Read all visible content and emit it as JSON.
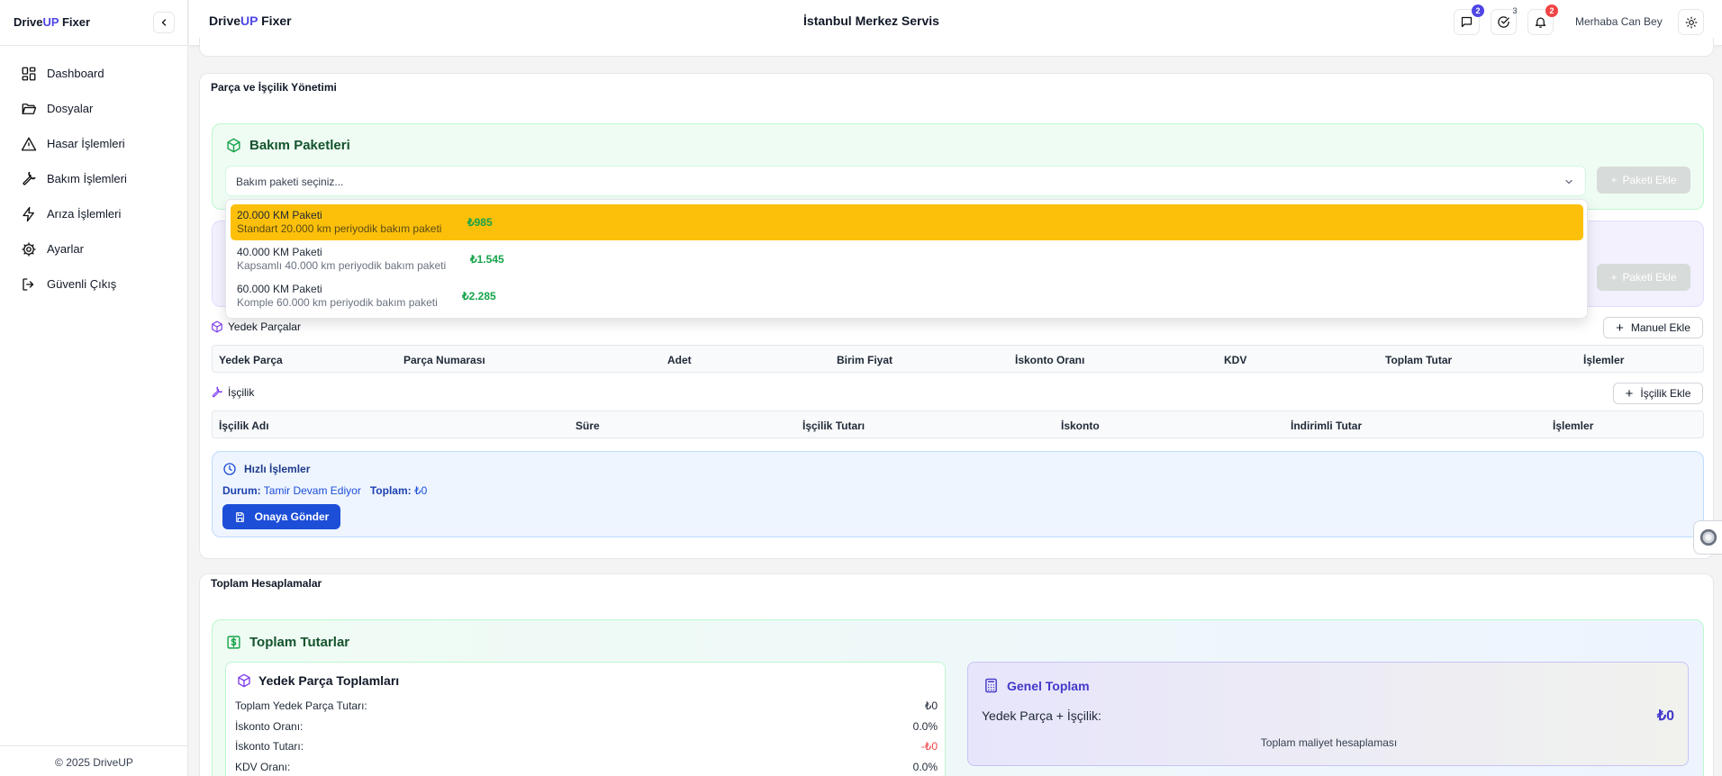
{
  "sidebar": {
    "brand_prefix": "Drive",
    "brand_up": "UP",
    "brand_suffix": " Fixer",
    "items": [
      {
        "label": "Dashboard"
      },
      {
        "label": "Dosyalar"
      },
      {
        "label": "Hasar İşlemleri"
      },
      {
        "label": "Bakım İşlemleri"
      },
      {
        "label": "Arıza İşlemleri"
      },
      {
        "label": "Ayarlar"
      },
      {
        "label": "Güvenli Çıkış"
      }
    ],
    "copyright": "© 2025 DriveUP"
  },
  "topbar": {
    "brand_prefix": "Drive",
    "brand_up": "UP",
    "brand_suffix": " Fixer",
    "center_title": "İstanbul Merkez Servis",
    "messages_count": "2",
    "tasks_count": "3",
    "notifications_count": "2",
    "greeting": "Merhaba Can Bey"
  },
  "parts_section": {
    "title": "Parça ve İşçilik Yönetimi",
    "packages_title": "Bakım Paketleri",
    "select_placeholder": "Bakım paketi seçiniz...",
    "add_package_label": "Paketi Ekle",
    "options": [
      {
        "name": "20.000 KM Paketi",
        "description": "Standart 20.000 km periyodik bakım paketi",
        "price": "₺985"
      },
      {
        "name": "40.000 KM Paketi",
        "description": "Kapsamlı 40.000 km periyodik bakım paketi",
        "price": "₺1.545"
      },
      {
        "name": "60.000 KM Paketi",
        "description": "Komple 60.000 km periyodik bakım paketi",
        "price": "₺2.285"
      }
    ],
    "spare_parts_label": "Yedek Parçalar",
    "manual_add_label": "Manuel Ekle",
    "spare_parts_columns": [
      "Yedek Parça",
      "Parça Numarası",
      "Adet",
      "Birim Fiyat",
      "İskonto Oranı",
      "KDV",
      "Toplam Tutar",
      "İşlemler"
    ],
    "labor_label": "İşçilik",
    "labor_add_label": "İşçilik Ekle",
    "labor_columns": [
      "İşçilik Adı",
      "Süre",
      "İşçilik Tutarı",
      "İskonto",
      "İndirimli Tutar",
      "İşlemler"
    ]
  },
  "quick_actions": {
    "title": "Hızlı İşlemler",
    "status_label": "Durum:",
    "status_value": "Tamir Devam Ediyor",
    "total_label": "Toplam:",
    "total_value": "₺0",
    "submit_label": "Onaya Gönder"
  },
  "totals": {
    "section_title": "Toplam Hesaplamalar",
    "panel_title": "Toplam Tutarlar",
    "parts_box_title": "Yedek Parça Toplamları",
    "rows": [
      {
        "label": "Toplam Yedek Parça Tutarı:",
        "value": "₺0"
      },
      {
        "label": "İskonto Oranı:",
        "value": "0.0%"
      },
      {
        "label": "İskonto Tutarı:",
        "value": "-₺0"
      },
      {
        "label": "KDV Oranı:",
        "value": "0.0%"
      }
    ],
    "grand_title": "Genel Toplam",
    "grand_label": "Yedek Parça + İşçilik:",
    "grand_value": "₺0",
    "grand_subtitle": "Toplam maliyet hesaplaması"
  },
  "colors": {
    "accent": "#4f46e5",
    "selected_option": "#fcc00a",
    "price_green": "#16a34a",
    "primary_button": "#1d4ed8",
    "negative_red": "#ef4444"
  }
}
